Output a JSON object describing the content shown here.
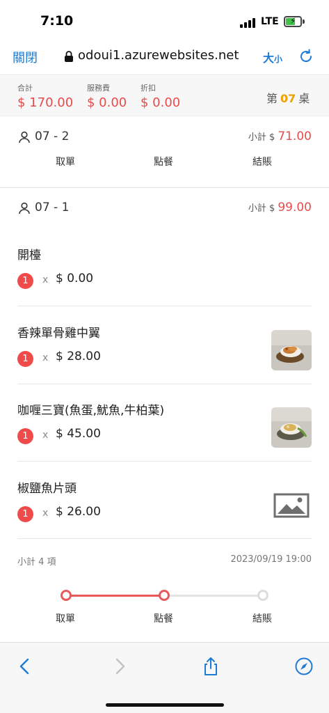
{
  "status_bar": {
    "time": "7:10",
    "network": "LTE"
  },
  "url_bar": {
    "close_label": "關閉",
    "url": "odoui1.azurewebsites.net",
    "size_big": "大",
    "size_small": "小"
  },
  "totals": {
    "total_label": "合計",
    "total_value": "$ 170.00",
    "service_label": "服務費",
    "service_value": "$ 0.00",
    "discount_label": "折扣",
    "discount_value": "$ 0.00",
    "table_prefix": "第",
    "table_number": "07",
    "table_suffix": "桌"
  },
  "orders": [
    {
      "id": "07 - 2",
      "subtotal_label": "小計 $",
      "subtotal_value": "71.00",
      "actions": [
        "取單",
        "點餐",
        "結賬"
      ]
    },
    {
      "id": "07 - 1",
      "subtotal_label": "小計 $",
      "subtotal_value": "99.00",
      "items": [
        {
          "name": "開檯",
          "qty": "1",
          "times": "x",
          "price": "$ 0.00"
        },
        {
          "name": "香辣單骨雞中翼",
          "qty": "1",
          "times": "x",
          "price": "$ 28.00"
        },
        {
          "name": "咖喱三寶(魚蛋,魷魚,牛柏葉)",
          "qty": "1",
          "times": "x",
          "price": "$ 45.00"
        },
        {
          "name": "椒鹽魚片頭",
          "qty": "1",
          "times": "x",
          "price": "$ 26.00"
        }
      ],
      "summary_left": "小計 4 項",
      "summary_right": "2023/09/19 19:00",
      "progress_steps": [
        "取單",
        "點餐",
        "結賬"
      ],
      "progress_completed_fraction": 0.5
    }
  ],
  "colors": {
    "accent_blue": "#1d7bd6",
    "price_red": "#e84b4b",
    "table_number_orange": "#f0a000",
    "progress_red": "#e85a5a"
  },
  "icons": {
    "person": "person-icon",
    "lock": "lock-icon",
    "reload": "reload-icon",
    "back": "back-arrow-icon",
    "forward": "forward-arrow-icon",
    "share": "share-icon",
    "compass": "compass-icon",
    "image_placeholder": "image-placeholder-icon"
  }
}
